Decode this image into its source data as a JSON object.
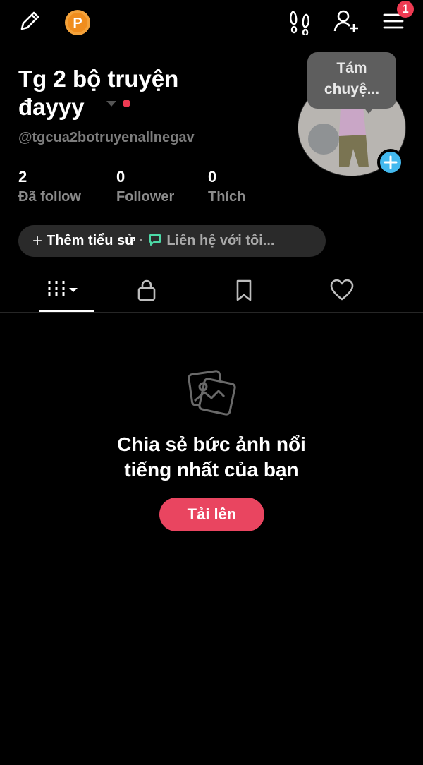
{
  "header": {
    "notification_badge": "1",
    "icons": [
      "edit-icon",
      "coin-icon",
      "footprint-icon",
      "add-user-icon",
      "menu-icon"
    ]
  },
  "profile": {
    "display_name": "Tg 2 bộ truyện đayyy",
    "username": "@tgcua2botruyenallnegav",
    "status_bubble": "Tám chuyệ...",
    "stats": [
      {
        "value": "2",
        "label": "Đã follow"
      },
      {
        "value": "0",
        "label": "Follower"
      },
      {
        "value": "0",
        "label": "Thích"
      }
    ],
    "add_bio_label": "Thêm tiểu sử",
    "contact_label": "Liên hệ với tôi..."
  },
  "tabs": [
    "posts-grid",
    "private",
    "saved",
    "liked"
  ],
  "empty_state": {
    "title_line1": "Chia sẻ bức ảnh nổi",
    "title_line2": "tiếng nhất của bạn",
    "upload_label": "Tải lên"
  },
  "colors": {
    "background": "#000000",
    "accent": "#e94560",
    "badge": "#ee3a52",
    "avatar_plus": "#43b9ef",
    "contact_icon": "#4cd9a6"
  }
}
